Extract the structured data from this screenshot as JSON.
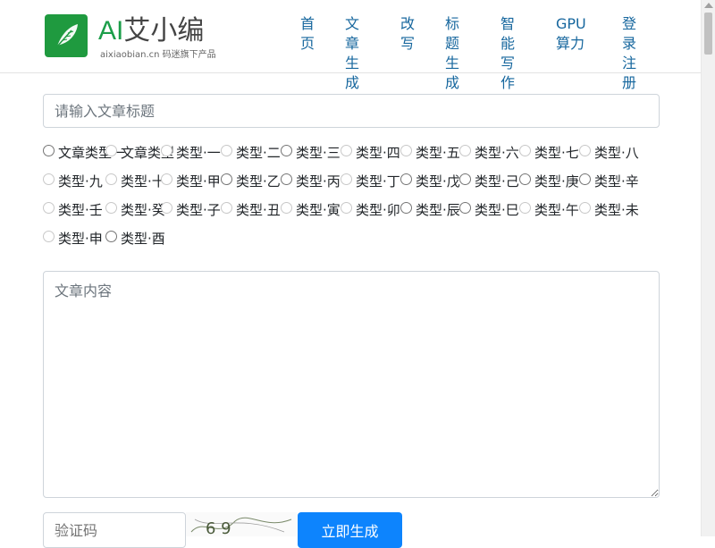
{
  "logo": {
    "title_en": "AI",
    "title_cn": "艾小编",
    "subtitle": "aixiaobian.cn 码迷旗下产品"
  },
  "nav": [
    {
      "label": "首页"
    },
    {
      "label": "文章生成"
    },
    {
      "label": "改写"
    },
    {
      "label": "标题生成"
    },
    {
      "label": "智能写作"
    },
    {
      "label": "GPU算力"
    },
    {
      "label": "登录注册"
    }
  ],
  "search": {
    "placeholder": "请输入文章标题"
  },
  "options": [
    "文章类型一",
    "文章类型",
    "类型·一",
    "类型·二",
    "类型·三",
    "类型·四",
    "类型·五",
    "类型·六",
    "类型·七",
    "类型·八",
    "类型·九",
    "类型·十",
    "类型·甲",
    "类型·乙",
    "类型·丙",
    "类型·丁",
    "类型·戊",
    "类型·己",
    "类型·庚",
    "类型·辛",
    "类型·壬",
    "类型·癸",
    "类型·子",
    "类型·丑",
    "类型·寅",
    "类型·卯",
    "类型·辰",
    "类型·巳",
    "类型·午",
    "类型·未",
    "类型·申",
    "类型·酉"
  ],
  "option_enabled": [
    true,
    false,
    false,
    false,
    true,
    false,
    false,
    false,
    false,
    false,
    false,
    false,
    false,
    true,
    true,
    false,
    true,
    true,
    true,
    true,
    false,
    false,
    false,
    false,
    false,
    false,
    true,
    true,
    false,
    false,
    false,
    true
  ],
  "content": {
    "placeholder": "文章内容"
  },
  "captcha": {
    "placeholder": "验证码",
    "image_text": "6 9"
  },
  "submit": {
    "label": "立即生成"
  },
  "colors": {
    "brand_green": "#1f9a3f",
    "link_blue": "#17679e",
    "button_blue": "#0d84fd"
  }
}
